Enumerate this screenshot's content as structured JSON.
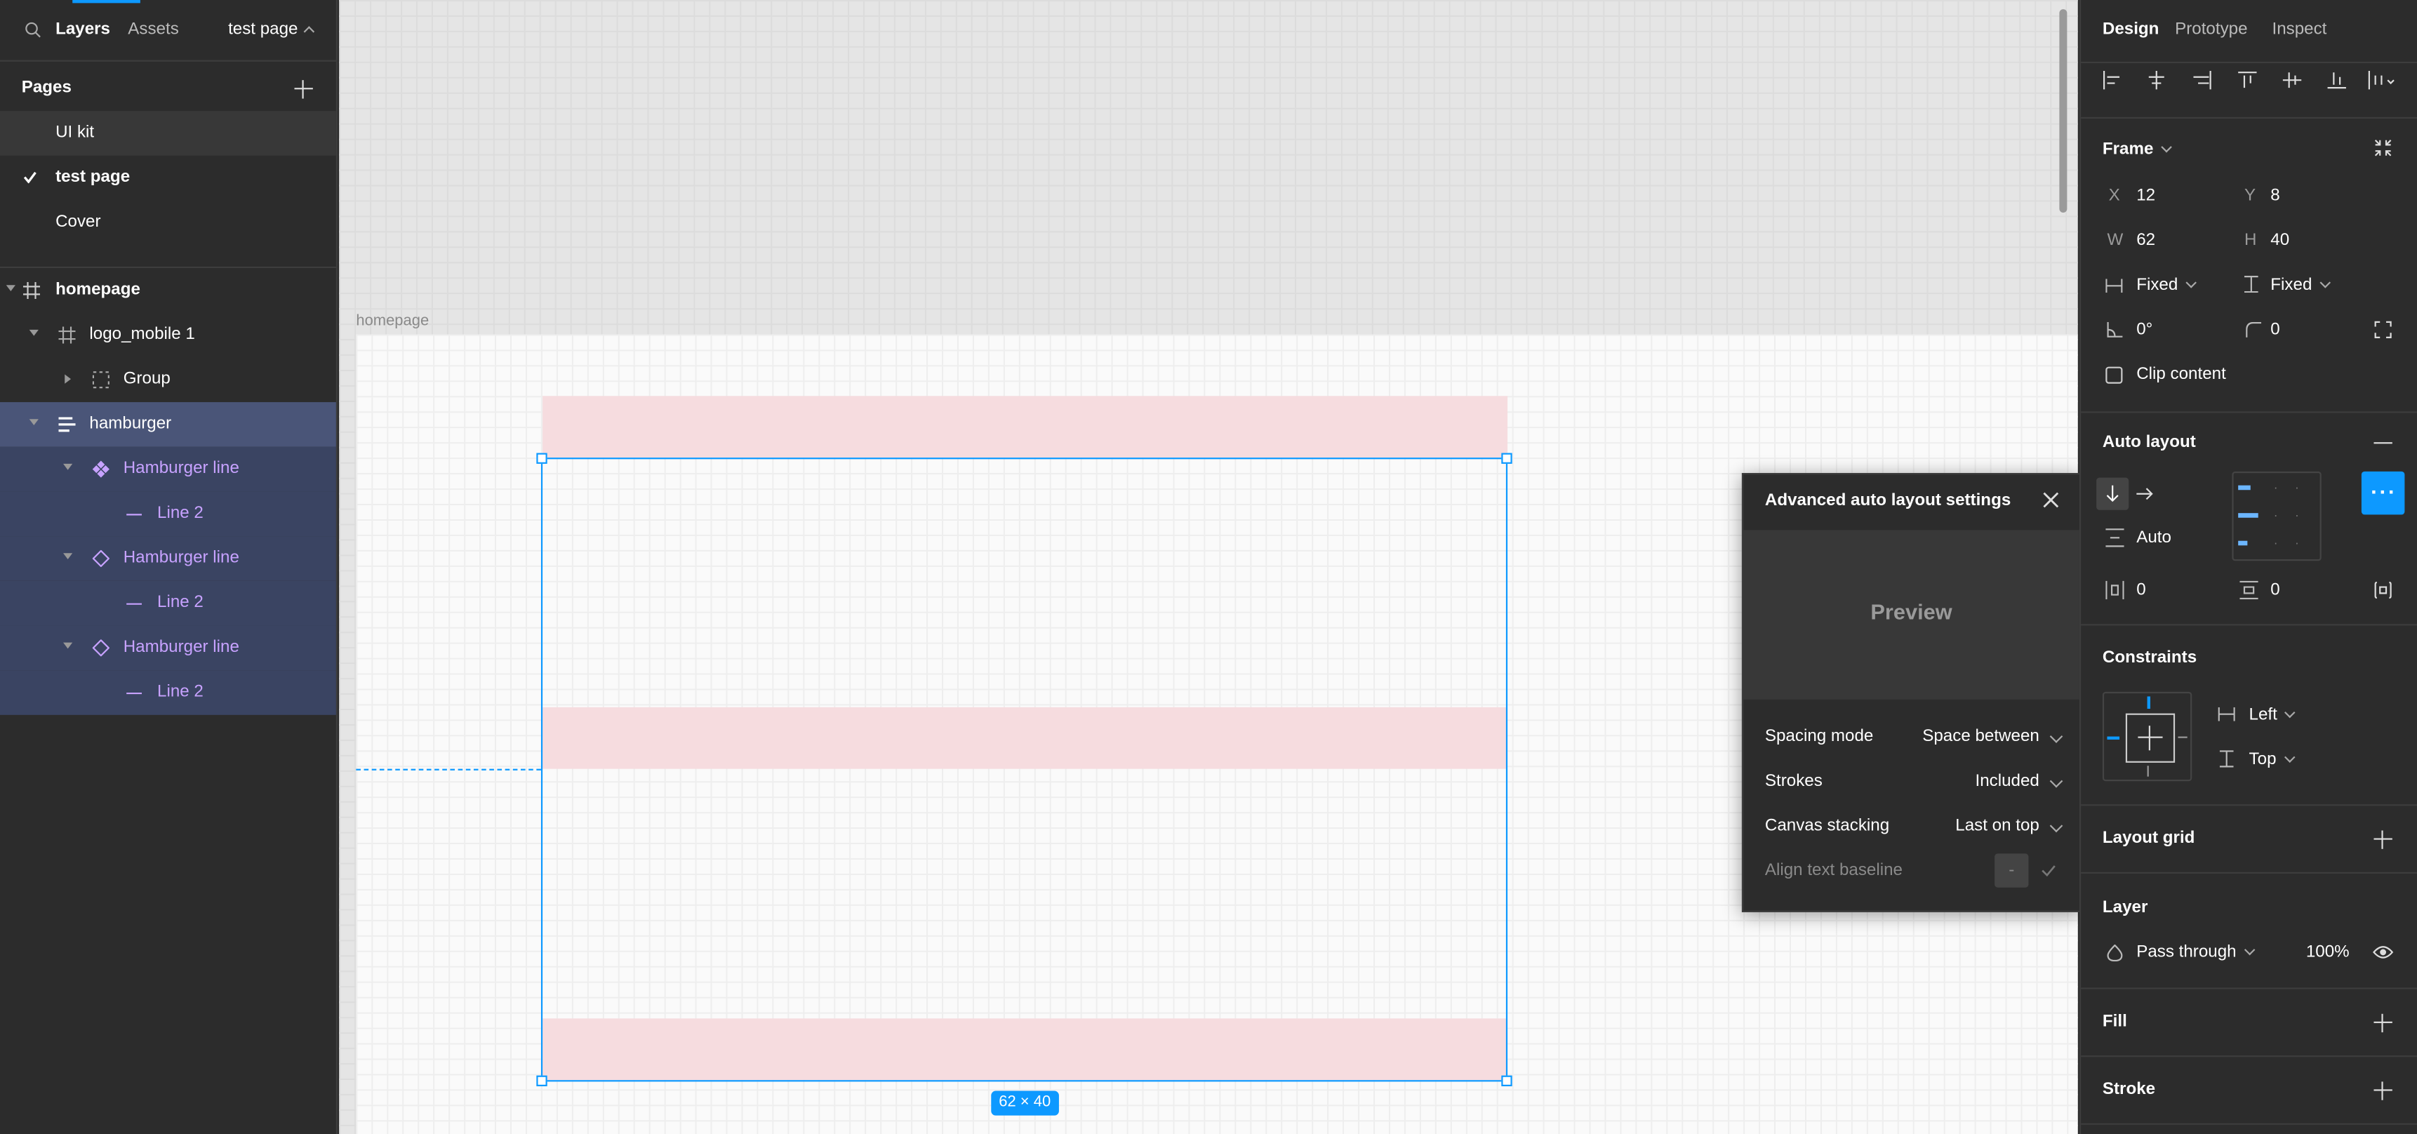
{
  "topbar": {
    "tab_layers": "Layers",
    "tab_assets": "Assets",
    "page_selector": "test page"
  },
  "pages": {
    "header": "Pages",
    "items": [
      {
        "label": "UI kit"
      },
      {
        "label": "test page",
        "current": true
      },
      {
        "label": "Cover"
      }
    ]
  },
  "layers": [
    {
      "label": "homepage",
      "icon": "frame-icon"
    },
    {
      "label": "logo_mobile 1",
      "icon": "frame-icon"
    },
    {
      "label": "Group",
      "icon": "group-icon"
    },
    {
      "label": "hamburger",
      "icon": "auto-layout-icon",
      "selected": true
    },
    {
      "label": "Hamburger line",
      "icon": "component-icon"
    },
    {
      "label": "Line 2",
      "icon": "line-icon"
    },
    {
      "label": "Hamburger line",
      "icon": "instance-icon"
    },
    {
      "label": "Line 2",
      "icon": "line-icon"
    },
    {
      "label": "Hamburger line",
      "icon": "instance-icon"
    },
    {
      "label": "Line 2",
      "icon": "line-icon"
    }
  ],
  "canvas": {
    "frame_label": "homepage",
    "size_badge": "62 × 40"
  },
  "popup": {
    "title": "Advanced auto layout settings",
    "preview": "Preview",
    "rows": [
      {
        "label": "Spacing mode",
        "value": "Space between"
      },
      {
        "label": "Strokes",
        "value": "Included"
      },
      {
        "label": "Canvas stacking",
        "value": "Last on top"
      },
      {
        "label": "Align text baseline",
        "value": "-"
      }
    ]
  },
  "right": {
    "tabs": [
      "Design",
      "Prototype",
      "Inspect"
    ],
    "frame": {
      "title": "Frame",
      "x_label": "X",
      "x": "12",
      "y_label": "Y",
      "y": "8",
      "w_label": "W",
      "w": "62",
      "h_label": "H",
      "h": "40",
      "hsize": "Fixed",
      "vsize": "Fixed",
      "rotation": "0°",
      "radius": "0",
      "clip": "Clip content"
    },
    "auto_layout": {
      "title": "Auto layout",
      "spacing": "Auto",
      "pad_h": "0",
      "pad_v": "0"
    },
    "constraints": {
      "title": "Constraints",
      "horizontal": "Left",
      "vertical": "Top"
    },
    "layout_grid": {
      "title": "Layout grid"
    },
    "layer": {
      "title": "Layer",
      "blend": "Pass through",
      "opacity": "100%"
    },
    "fill": {
      "title": "Fill"
    },
    "stroke": {
      "title": "Stroke"
    }
  },
  "colors": {
    "accent": "#0d99ff",
    "panel": "#2c2c2c",
    "selection_row": "#3a4462",
    "component": "#c7a2ff",
    "pink_bar": "#f6dcdf"
  }
}
